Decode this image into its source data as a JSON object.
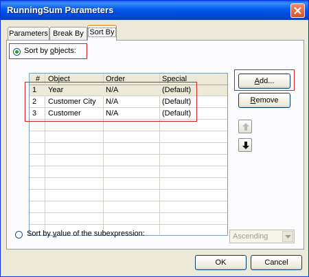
{
  "window": {
    "title": "RunningSum Parameters"
  },
  "tabs": [
    {
      "label": "Parameters"
    },
    {
      "label": "Break By"
    },
    {
      "label": "Sort By"
    }
  ],
  "sort_by_objects": {
    "label_before": "Sort by ",
    "accel": "o",
    "label_after": "bjects:",
    "selected": true
  },
  "grid": {
    "columns": [
      "#",
      "Object",
      "Order",
      "Special"
    ],
    "rows": [
      {
        "num": "1",
        "object": "Year",
        "order": "N/A",
        "special": "(Default)"
      },
      {
        "num": "2",
        "object": "Customer City",
        "order": "N/A",
        "special": "(Default)"
      },
      {
        "num": "3",
        "object": "Customer",
        "order": "N/A",
        "special": "(Default)"
      }
    ]
  },
  "buttons": {
    "add": {
      "accel": "A",
      "rest": "dd..."
    },
    "remove": {
      "accel": "R",
      "rest": "emove"
    },
    "move_up_icon": "arrow-up-icon",
    "move_down_icon": "arrow-down-icon",
    "ok": "OK",
    "cancel": "Cancel"
  },
  "sort_by_value": {
    "label_before": "Sort by ",
    "accel": "v",
    "label_after": "alue of the subexpression:",
    "selected": false
  },
  "order_select": {
    "value": "Ascending",
    "disabled": true
  },
  "colors": {
    "highlight_box": "#d02020",
    "titlebar": "#0058ee"
  }
}
